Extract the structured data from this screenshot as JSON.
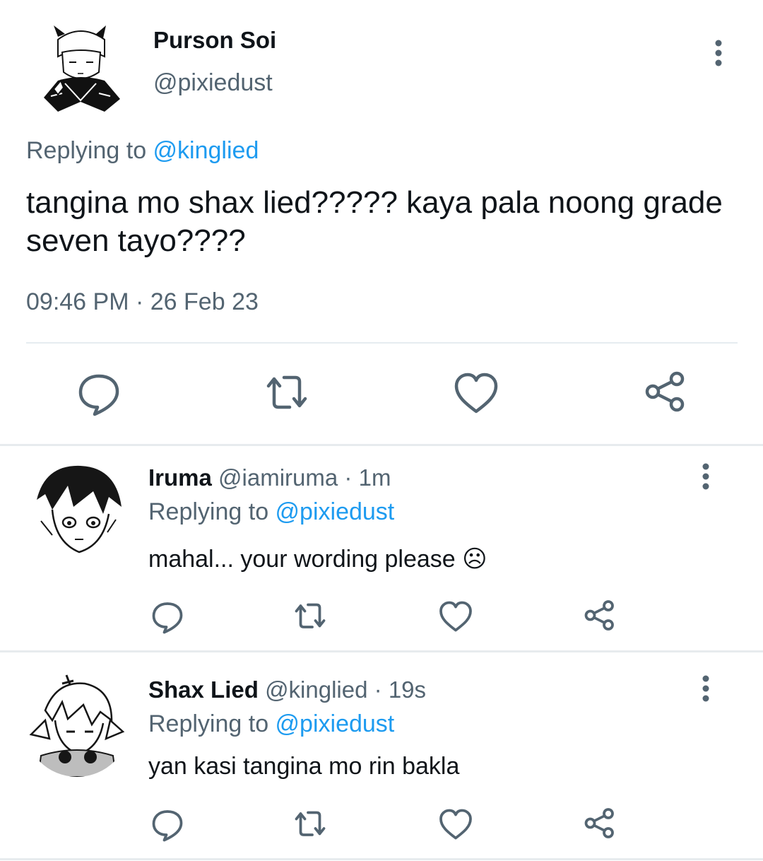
{
  "main_tweet": {
    "author_name": "Purson Soi",
    "author_handle": "@pixiedust",
    "replying_label": "Replying to ",
    "replying_to": "@kinglied",
    "text": "tangina mo shax lied????? kaya pala noong grade seven tayo????",
    "time": "09:46 PM",
    "separator": "·",
    "date": "26 Feb 23",
    "icons": [
      "reply-icon",
      "retweet-icon",
      "like-icon",
      "share-icon",
      "more-vertical-icon"
    ]
  },
  "replies": [
    {
      "author_name": "Iruma",
      "author_handle": "@iamiruma",
      "separator": "·",
      "age": "1m",
      "replying_label": "Replying to ",
      "replying_to": "@pixiedust",
      "text": "mahal... your wording please ☹"
    },
    {
      "author_name": "Shax Lied",
      "author_handle": "@kinglied",
      "separator": "·",
      "age": "19s",
      "replying_label": "Replying to ",
      "replying_to": "@pixiedust",
      "text": "yan kasi tangina mo rin bakla"
    }
  ],
  "colors": {
    "text": "#0f1419",
    "muted": "#536471",
    "link": "#1d9bf0",
    "divider": "#e6ecf0"
  }
}
